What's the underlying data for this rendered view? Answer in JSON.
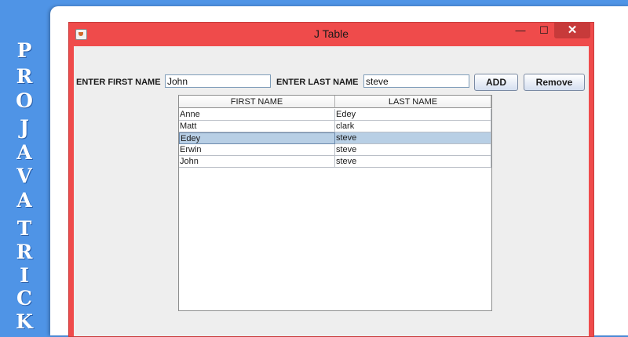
{
  "brand": {
    "letters": [
      "P",
      "R",
      "O",
      "J",
      "A",
      "V",
      "A",
      "T",
      "R",
      "I",
      "C",
      "K"
    ]
  },
  "window": {
    "title": "J Table",
    "minimize_glyph": "—",
    "maximize_glyph": "☐",
    "close_glyph": "✕"
  },
  "form": {
    "first_label": "ENTER FIRST NAME",
    "first_value": "John",
    "last_label": "ENTER LAST NAME",
    "last_value": "steve",
    "add_label": "ADD",
    "remove_label": "Remove"
  },
  "table": {
    "columns": [
      "FIRST NAME",
      "LAST NAME"
    ],
    "rows": [
      [
        "Anne",
        "Edey"
      ],
      [
        "Matt",
        "clark"
      ],
      [
        "Edey",
        "steve"
      ],
      [
        "Erwin",
        "steve"
      ],
      [
        "John",
        "steve"
      ]
    ],
    "selected_row": 2
  },
  "colors": {
    "window_frame": "#ef4b4b",
    "selection": "#b8cfe5",
    "brand_strip": "#4f94e6"
  }
}
